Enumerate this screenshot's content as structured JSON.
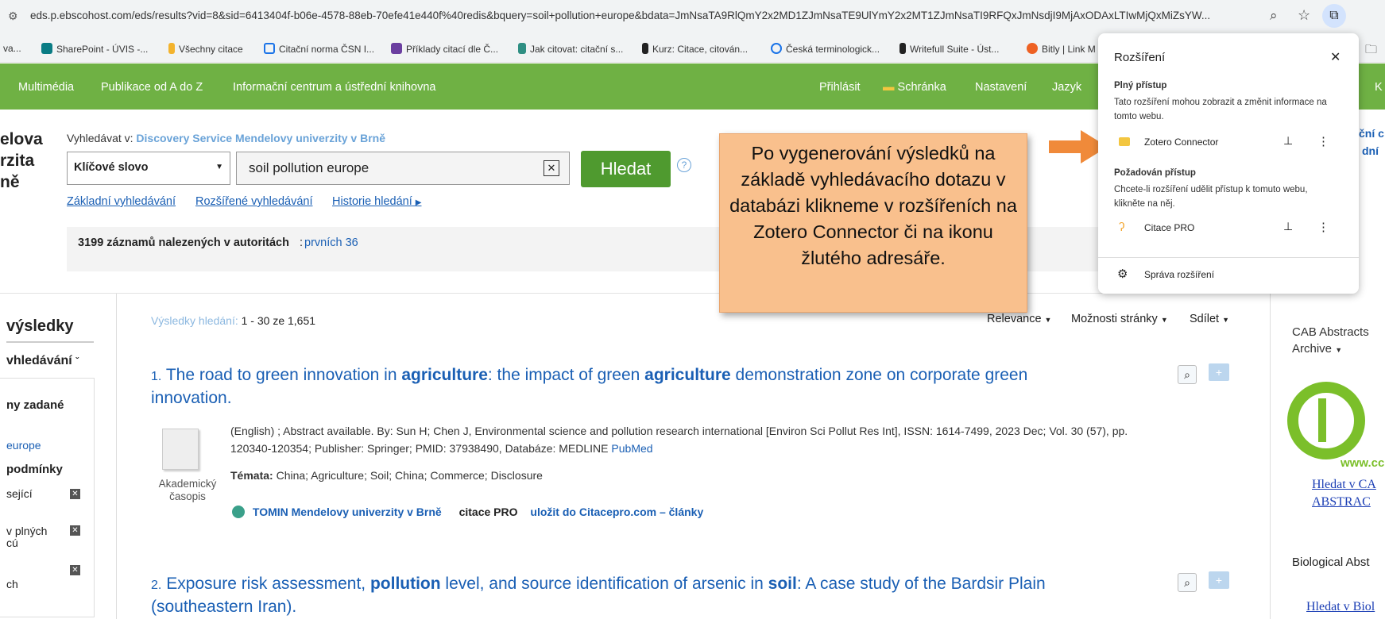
{
  "browser": {
    "url": "eds.p.ebscohost.com/eds/results?vid=8&sid=6413404f-b06e-4578-88eb-70efe41e440f%40redis&bquery=soil+pollution+europe&bdata=JmNsaTA9RlQmY2x2MD1ZJmNsaTE9UlYmY2x2MT1ZJmNsaTI9RFQxJmNsdjI9MjAxODAxLTIwMjQxMiZsYW...",
    "bookmarks": [
      "va...",
      "SharePoint - ÚVIS -...",
      "Všechny citace",
      "Citační norma ČSN I...",
      "Příklady citací dle Č...",
      "Jak citovat: citační s...",
      "Kurz: Citace, citován...",
      "Česká terminologick...",
      "Writefull Suite - Úst...",
      "Bitly | Link M"
    ]
  },
  "nav": {
    "left": [
      "Multimédia",
      "Publikace od A do Z",
      "Informační centrum a ústřední knihovna"
    ],
    "right": [
      "Přihlásit",
      "Schránka",
      "Nastavení",
      "Jazyk"
    ],
    "edge": "K"
  },
  "logo_fragments": [
    "elova",
    "rzita",
    "ně"
  ],
  "search": {
    "search_in_label": "Vyhledávat v:",
    "search_in_value": "Discovery Service Mendelovy univerzity v Brně",
    "field_select": "Klíčové slovo",
    "query": "soil pollution europe",
    "button": "Hledat",
    "help": "?",
    "links": [
      "Základní vyhledávání",
      "Rozšířené vyhledávání",
      "Historie hledání"
    ]
  },
  "authorities": {
    "text": "3199 záznamů nalezených v autoritách",
    "link": "prvních 36"
  },
  "sidebar": {
    "heading": "výsledky",
    "subheading": "vhledávání",
    "section": "ny zadané",
    "term": "europe",
    "conditions": "podmínky",
    "items": [
      "sející",
      "v plných",
      "cú",
      "ch"
    ]
  },
  "results_bar": {
    "label": "Výsledky hledání:",
    "range": "1 - 30 ze 1,651",
    "relevance": "Relevance",
    "options": "Možnosti stránky",
    "share": "Sdílet"
  },
  "results": [
    {
      "number": "1.",
      "title_parts": [
        "The road to green innovation in ",
        "agriculture",
        ": the impact of green ",
        "agriculture",
        " demonstration zone on corporate green",
        "innovation."
      ],
      "meta_line1": "(English) ; Abstract available. By: Sun H; Chen J, Environmental science and pollution research international [Environ Sci Pollut Res Int], ISSN: 1614-7499, 2023 Dec; Vol. 30 (57), pp.",
      "meta_line2_a": "120340-120354; Publisher: Springer; PMID: 37938490, Databáze: MEDLINE",
      "meta_line2_link": "PubMed",
      "subjects_label": "Témata:",
      "subjects": "China; Agriculture; Soil; China; Commerce; Disclosure",
      "type": [
        "Akademický",
        "časopis"
      ],
      "links": [
        "TOMIN Mendelovy univerzity v Brně",
        "citace PRO",
        "uložit do Citacepro.com – články"
      ]
    },
    {
      "number": "2.",
      "title_parts": [
        "Exposure risk assessment, ",
        "pollution",
        " level, and source identification of arsenic in ",
        "soil",
        ": A case study of the Bardsir Plain",
        "(southeastern Iran)."
      ]
    }
  ],
  "right_panel": {
    "cab_title": "CAB Abstracts",
    "cab_sub": "Archive",
    "cab_logo_url": "www.cc",
    "cab_link1": "Hledat v CA",
    "cab_link2": "ABSTRAC",
    "bio_title": "Biological Abst",
    "bio_link": "Hledat v Biol",
    "edge1": "ční c",
    "edge2": "dní"
  },
  "callout": {
    "text": "Po vygenerování výsledků na základě vyhledávacího dotazu v databázi klikneme v rozšířeních na Zotero Connector či na ikonu žlutého adresáře."
  },
  "extensions": {
    "title": "Rozšíření",
    "full_access": "Plný přístup",
    "full_desc": "Tato rozšíření mohou zobrazit a změnit informace na tomto webu.",
    "zotero": "Zotero Connector",
    "requested": "Požadován přístup",
    "requested_desc": "Chcete-li rozšíření udělit přístup k tomuto webu, klikněte na něj.",
    "citace": "Citace PRO",
    "manage": "Správa rozšíření"
  },
  "colors": {
    "nav": "#6fb144",
    "button": "#4f9a2f",
    "link": "#1a5fb4",
    "callout": "#f9c08d",
    "arrow": "#f08a3a"
  }
}
